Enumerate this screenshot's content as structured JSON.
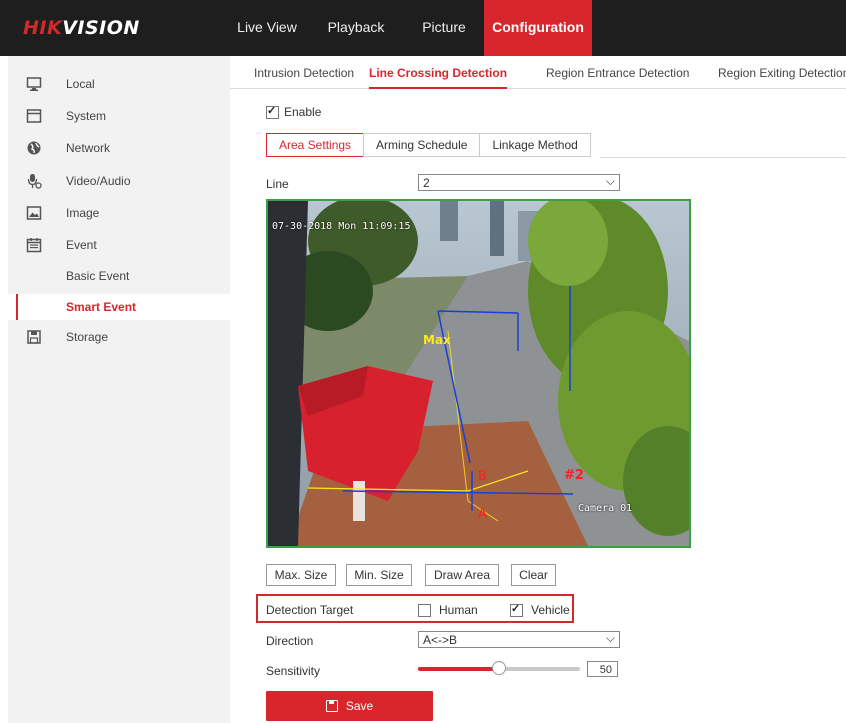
{
  "brand": {
    "logo_red": "HIK",
    "logo_white": "VISION"
  },
  "nav": [
    {
      "label": "Live View",
      "width": 74
    },
    {
      "label": "Playback",
      "width": 104
    },
    {
      "label": "Picture",
      "width": 72
    },
    {
      "label": "Configuration",
      "width": 108
    }
  ],
  "sidebar": {
    "local": "Local",
    "system": "System",
    "network": "Network",
    "video_audio": "Video/Audio",
    "image": "Image",
    "event": "Event",
    "basic_event": "Basic Event",
    "smart_event": "Smart Event",
    "storage": "Storage"
  },
  "tabs": {
    "intrusion": "Intrusion Detection",
    "line_crossing": "Line Crossing Detection",
    "region_entrance": "Region Entrance Detection",
    "region_exiting": "Region Exiting Detection"
  },
  "enable": {
    "label": "Enable",
    "checked": true
  },
  "subtabs": {
    "area_settings": "Area Settings",
    "arming_schedule": "Arming Schedule",
    "linkage_method": "Linkage Method"
  },
  "line": {
    "label": "Line",
    "value": "2"
  },
  "video": {
    "osd_time": "07-30-2018 Mon 11:09:15",
    "camera_name": "Camera 01",
    "marker_b": "B",
    "marker_a": "A",
    "line_tag": "#2",
    "max_tag": "Max"
  },
  "buttons": {
    "max_size": "Max. Size",
    "min_size": "Min. Size",
    "draw_area": "Draw Area",
    "clear": "Clear"
  },
  "detection_target": {
    "label": "Detection Target",
    "human": "Human",
    "human_checked": false,
    "vehicle": "Vehicle",
    "vehicle_checked": true
  },
  "direction": {
    "label": "Direction",
    "value": "A<->B"
  },
  "sensitivity": {
    "label": "Sensitivity",
    "value": "50",
    "fraction": 0.5
  },
  "save": {
    "label": "Save"
  },
  "colors": {
    "accent": "#d8262d",
    "header_bg": "#1e1e1e",
    "sidebar_bg": "#f2f2f2",
    "rule_line": "#1a3fd8",
    "yellow": "#ffe81a"
  }
}
